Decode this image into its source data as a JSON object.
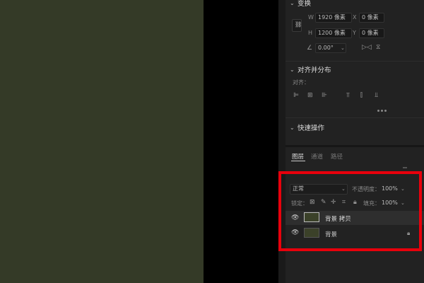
{
  "transform": {
    "title": "变换",
    "width_label": "W",
    "width_value": "1920 像素",
    "height_label": "H",
    "height_value": "1200 像素",
    "x_label": "X",
    "x_value": "0 像素",
    "y_label": "Y",
    "y_value": "0 像素",
    "angle_value": "0.00°"
  },
  "align": {
    "title": "对齐并分布",
    "sub_label": "对齐："
  },
  "quick_actions": {
    "title": "快速操作"
  },
  "tabs": [
    {
      "label": "图层",
      "active": true
    },
    {
      "label": "通道",
      "active": false
    },
    {
      "label": "路径",
      "active": false
    }
  ],
  "layers_panel": {
    "blend_mode": "正常",
    "opacity_label": "不透明度：",
    "opacity_value": "100%",
    "lock_label": "锁定：",
    "fill_label": "填充：",
    "fill_value": "100%",
    "layers": [
      {
        "name": "背景 拷贝",
        "selected": true
      },
      {
        "name": "背景",
        "selected": false,
        "locked": true
      }
    ]
  },
  "colors": {
    "canvas": "#343a27",
    "highlight": "#e8000c"
  }
}
